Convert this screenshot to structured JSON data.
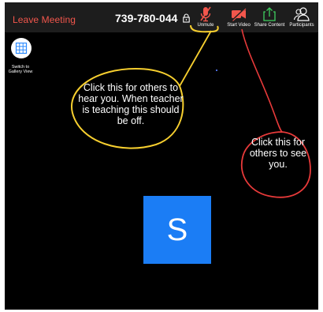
{
  "topbar": {
    "leave_label": "Leave Meeting",
    "meeting_id": "739-780-044",
    "tools": [
      {
        "label": "Unmute",
        "icon": "microphone-muted-icon"
      },
      {
        "label": "Start Video",
        "icon": "video-off-icon"
      },
      {
        "label": "Share Content",
        "icon": "share-content-icon"
      },
      {
        "label": "Participants",
        "icon": "participants-icon"
      }
    ]
  },
  "sidebar": {
    "gallery_label": "Switch to Gallery View"
  },
  "participant": {
    "initial": "S"
  },
  "annotations": {
    "audio_note": "Click this for others to hear you. When teacher is teaching this should be off.",
    "video_note": "Click this for others to see you."
  },
  "colors": {
    "leave": "#f2564c",
    "muted_icon": "#f2564c",
    "avatar": "#1b7df5",
    "share_icon": "#3fcf5f",
    "yellow_annotation": "#f7cf2f",
    "red_annotation": "#e83a3a"
  }
}
